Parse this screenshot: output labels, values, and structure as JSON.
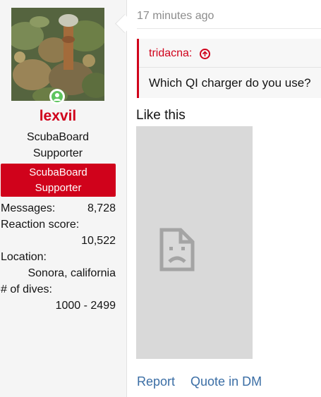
{
  "user": {
    "name": "lexvil",
    "title_line1": "ScubaBoard",
    "title_line2": "Supporter",
    "banner_line1": "ScubaBoard",
    "banner_line2": "Supporter",
    "stats": [
      {
        "label": "Messages:",
        "value": "8,728"
      },
      {
        "label": "Reaction score:",
        "value": "10,522"
      },
      {
        "label": "Location:",
        "value": "Sonora, california"
      },
      {
        "label": "# of dives:",
        "value": "1000 - 2499"
      }
    ],
    "online_icon": "user-online-icon"
  },
  "post": {
    "timestamp": "17 minutes ago",
    "quote_author": "tridacna:",
    "quote_text": "Which QI charger do you use?",
    "like_text": "Like this",
    "broken_image_icon": "broken-image-icon"
  },
  "actions": {
    "report": "Report",
    "quote_dm": "Quote in DM"
  },
  "colors": {
    "accent_red": "#d0021b",
    "link_blue": "#3b6ea5",
    "online_green": "#5ec45e"
  }
}
